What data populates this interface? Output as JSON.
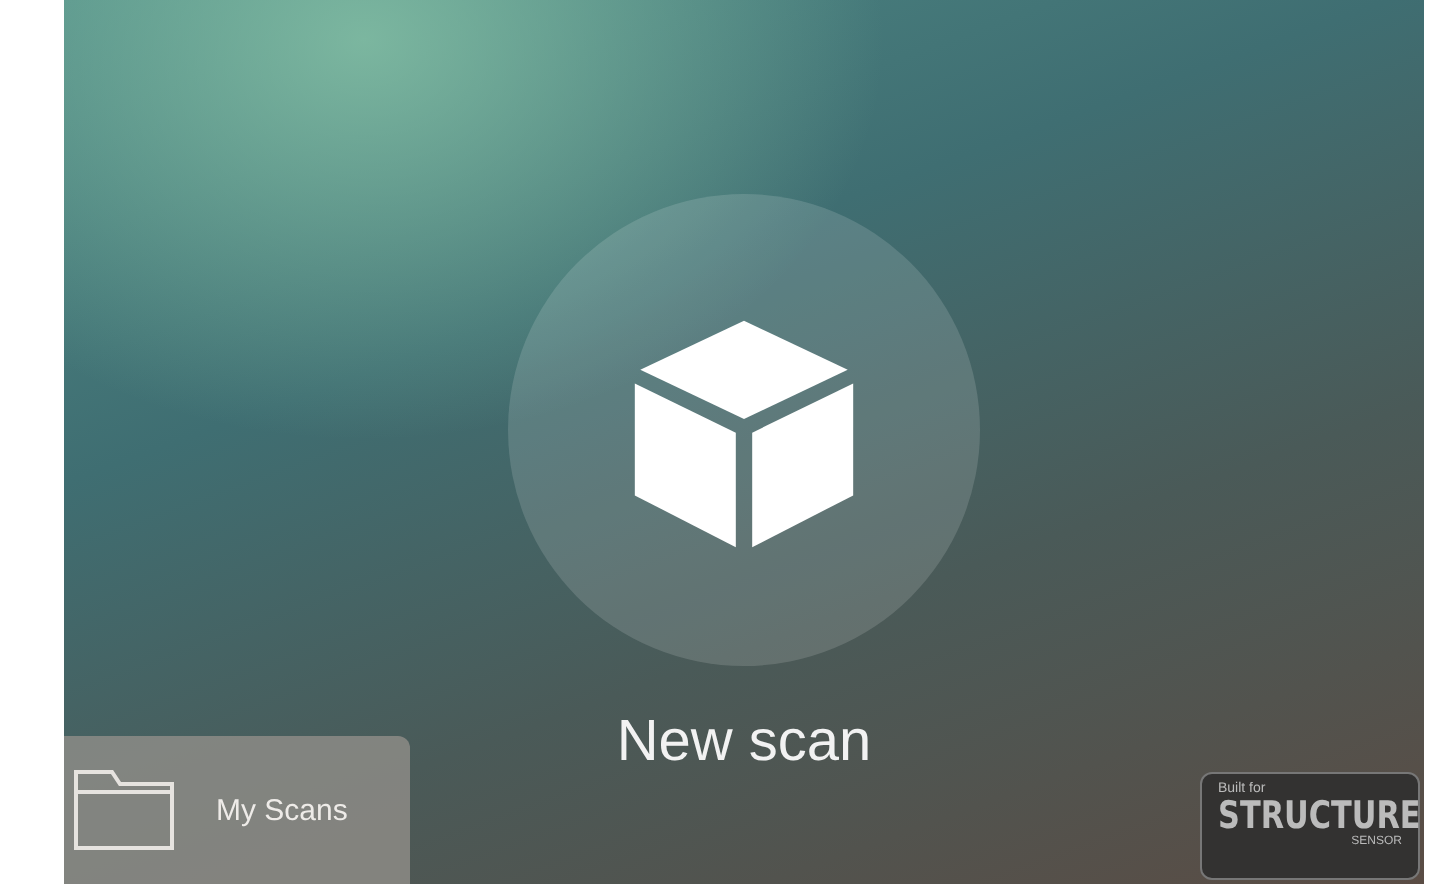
{
  "new_scan": {
    "label": "New scan"
  },
  "my_scans": {
    "label": "My Scans"
  },
  "badge": {
    "top": "Built for",
    "main": "STRUCTURE",
    "bottom": "SENSOR"
  }
}
